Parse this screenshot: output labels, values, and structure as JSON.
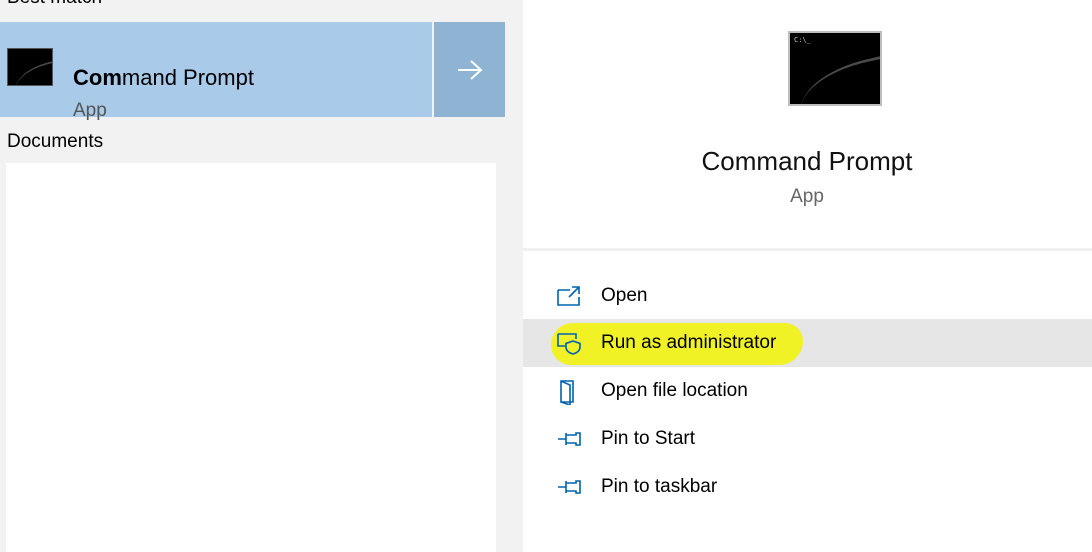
{
  "left": {
    "best_match_heading": "Best match",
    "best_match": {
      "title_bold": "Com",
      "title_rest": "mand Prompt",
      "subtitle": "App",
      "icon": "command-prompt-icon",
      "arrow_icon": "arrow-right-icon"
    },
    "documents_heading": "Documents"
  },
  "right": {
    "icon": "command-prompt-icon",
    "icon_prompt": "C:\\_",
    "title": "Command Prompt",
    "subtitle": "App",
    "actions": [
      {
        "label": "Open",
        "icon": "open-window-icon"
      },
      {
        "label": "Run as administrator",
        "icon": "admin-shield-icon"
      },
      {
        "label": "Open file location",
        "icon": "folder-door-icon"
      },
      {
        "label": "Pin to Start",
        "icon": "pin-icon"
      },
      {
        "label": "Pin to taskbar",
        "icon": "pin-icon"
      }
    ]
  },
  "colors": {
    "accent_icon": "#0063b1",
    "selected_bg": "#a9cae8",
    "arrow_bg": "#8fb3d3",
    "hover_bg": "#e6e6e6",
    "highlight": "#f1f21b"
  }
}
